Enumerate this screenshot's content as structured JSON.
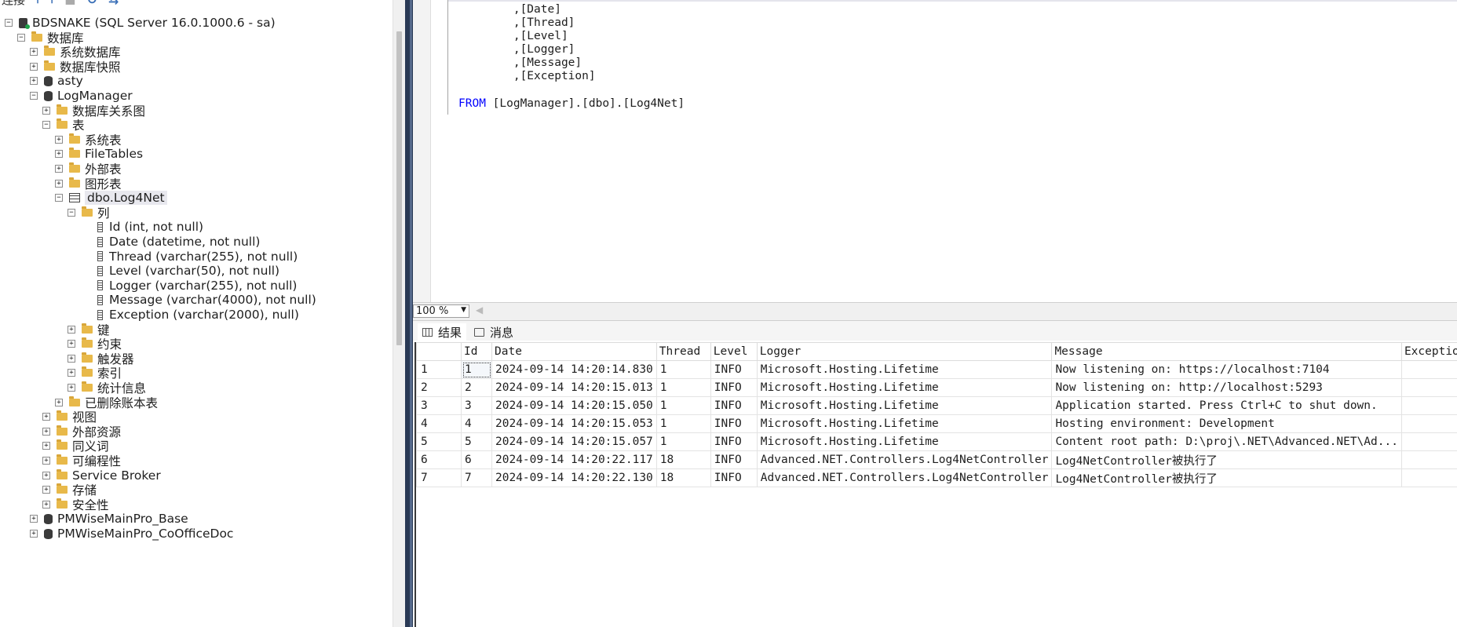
{
  "explorer": {
    "toolbar": {
      "connect_label": "连接"
    },
    "nodes": [
      {
        "label": "BDSNAKE (SQL Server 16.0.1000.6 - sa)",
        "depth": 0,
        "exp": "minus",
        "icon": "server"
      },
      {
        "label": "数据库",
        "depth": 1,
        "exp": "minus",
        "icon": "folder"
      },
      {
        "label": "系统数据库",
        "depth": 2,
        "exp": "plus",
        "icon": "folder"
      },
      {
        "label": "数据库快照",
        "depth": 2,
        "exp": "plus",
        "icon": "folder"
      },
      {
        "label": "asty",
        "depth": 2,
        "exp": "plus",
        "icon": "db"
      },
      {
        "label": "LogManager",
        "depth": 2,
        "exp": "minus",
        "icon": "db"
      },
      {
        "label": "数据库关系图",
        "depth": 3,
        "exp": "plus",
        "icon": "folder"
      },
      {
        "label": "表",
        "depth": 3,
        "exp": "minus",
        "icon": "folder"
      },
      {
        "label": "系统表",
        "depth": 4,
        "exp": "plus",
        "icon": "folder"
      },
      {
        "label": "FileTables",
        "depth": 4,
        "exp": "plus",
        "icon": "folder"
      },
      {
        "label": "外部表",
        "depth": 4,
        "exp": "plus",
        "icon": "folder"
      },
      {
        "label": "图形表",
        "depth": 4,
        "exp": "plus",
        "icon": "folder"
      },
      {
        "label": "dbo.Log4Net",
        "depth": 4,
        "exp": "minus",
        "icon": "table",
        "selected": true
      },
      {
        "label": "列",
        "depth": 5,
        "exp": "minus",
        "icon": "folder"
      },
      {
        "label": "Id (int, not null)",
        "depth": 6,
        "exp": "none",
        "icon": "column"
      },
      {
        "label": "Date (datetime, not null)",
        "depth": 6,
        "exp": "none",
        "icon": "column"
      },
      {
        "label": "Thread (varchar(255), not null)",
        "depth": 6,
        "exp": "none",
        "icon": "column"
      },
      {
        "label": "Level (varchar(50), not null)",
        "depth": 6,
        "exp": "none",
        "icon": "column"
      },
      {
        "label": "Logger (varchar(255), not null)",
        "depth": 6,
        "exp": "none",
        "icon": "column"
      },
      {
        "label": "Message (varchar(4000), not null)",
        "depth": 6,
        "exp": "none",
        "icon": "column"
      },
      {
        "label": "Exception (varchar(2000), null)",
        "depth": 6,
        "exp": "none",
        "icon": "column"
      },
      {
        "label": "键",
        "depth": 5,
        "exp": "plus",
        "icon": "folder"
      },
      {
        "label": "约束",
        "depth": 5,
        "exp": "plus",
        "icon": "folder"
      },
      {
        "label": "触发器",
        "depth": 5,
        "exp": "plus",
        "icon": "folder"
      },
      {
        "label": "索引",
        "depth": 5,
        "exp": "plus",
        "icon": "folder"
      },
      {
        "label": "统计信息",
        "depth": 5,
        "exp": "plus",
        "icon": "folder"
      },
      {
        "label": "已删除账本表",
        "depth": 4,
        "exp": "plus",
        "icon": "folder"
      },
      {
        "label": "视图",
        "depth": 3,
        "exp": "plus",
        "icon": "folder"
      },
      {
        "label": "外部资源",
        "depth": 3,
        "exp": "plus",
        "icon": "folder"
      },
      {
        "label": "同义词",
        "depth": 3,
        "exp": "plus",
        "icon": "folder"
      },
      {
        "label": "可编程性",
        "depth": 3,
        "exp": "plus",
        "icon": "folder"
      },
      {
        "label": "Service Broker",
        "depth": 3,
        "exp": "plus",
        "icon": "folder"
      },
      {
        "label": "存储",
        "depth": 3,
        "exp": "plus",
        "icon": "folder"
      },
      {
        "label": "安全性",
        "depth": 3,
        "exp": "plus",
        "icon": "folder"
      },
      {
        "label": "PMWiseMainPro_Base",
        "depth": 2,
        "exp": "plus",
        "icon": "db"
      },
      {
        "label": "PMWiseMainPro_CoOfficeDoc",
        "depth": 2,
        "exp": "plus",
        "icon": "db"
      }
    ]
  },
  "editor": {
    "lines": [
      {
        "indent": "        ",
        "text": ",[Date]"
      },
      {
        "indent": "        ",
        "text": ",[Thread]"
      },
      {
        "indent": "        ",
        "text": ",[Level]"
      },
      {
        "indent": "        ",
        "text": ",[Logger]"
      },
      {
        "indent": "        ",
        "text": ",[Message]"
      },
      {
        "indent": "        ",
        "text": ",[Exception]"
      }
    ],
    "from_keyword": "FROM",
    "from_rest": " [LogManager].[dbo].[Log4Net]"
  },
  "zoom": {
    "value": "100 %"
  },
  "results": {
    "tabs": [
      {
        "label": "结果",
        "icon": "grid-icon",
        "active": true
      },
      {
        "label": "消息",
        "icon": "message-icon",
        "active": false
      }
    ],
    "columns": [
      "",
      "Id",
      "Date",
      "Thread",
      "Level",
      "Logger",
      "Message",
      "Exception"
    ],
    "rows": [
      [
        "1",
        "1",
        "2024-09-14 14:20:14.830",
        "1",
        "INFO",
        "Microsoft.Hosting.Lifetime",
        "Now listening on: https://localhost:7104",
        ""
      ],
      [
        "2",
        "2",
        "2024-09-14 14:20:15.013",
        "1",
        "INFO",
        "Microsoft.Hosting.Lifetime",
        "Now listening on: http://localhost:5293",
        ""
      ],
      [
        "3",
        "3",
        "2024-09-14 14:20:15.050",
        "1",
        "INFO",
        "Microsoft.Hosting.Lifetime",
        "Application started. Press Ctrl+C to shut down.",
        ""
      ],
      [
        "4",
        "4",
        "2024-09-14 14:20:15.053",
        "1",
        "INFO",
        "Microsoft.Hosting.Lifetime",
        "Hosting environment: Development",
        ""
      ],
      [
        "5",
        "5",
        "2024-09-14 14:20:15.057",
        "1",
        "INFO",
        "Microsoft.Hosting.Lifetime",
        "Content root path: D:\\proj\\.NET\\Advanced.NET\\Ad...",
        ""
      ],
      [
        "6",
        "6",
        "2024-09-14 14:20:22.117",
        "18",
        "INFO",
        "Advanced.NET.Controllers.Log4NetController",
        "Log4NetController被执行了",
        ""
      ],
      [
        "7",
        "7",
        "2024-09-14 14:20:22.130",
        "18",
        "INFO",
        "Advanced.NET.Controllers.Log4NetController",
        "Log4NetController被执行了",
        ""
      ]
    ]
  }
}
